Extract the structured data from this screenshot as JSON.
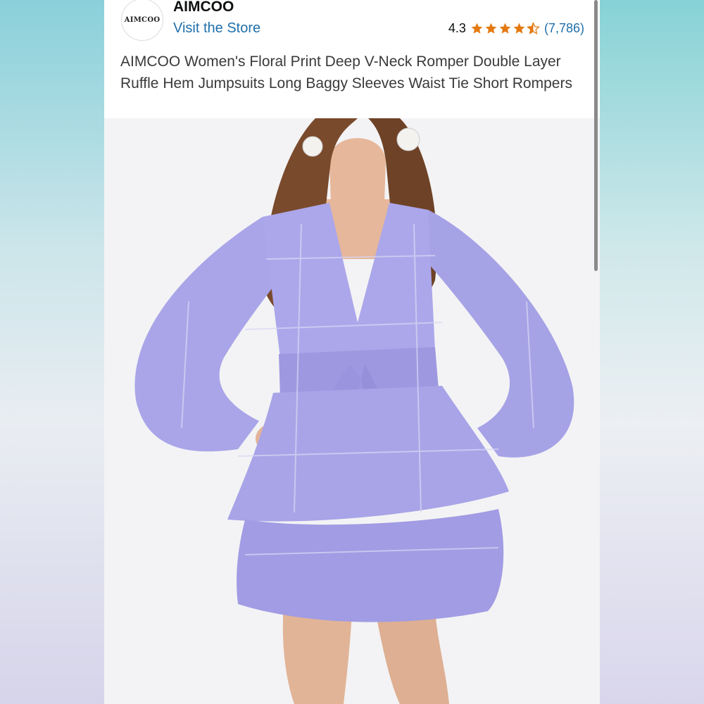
{
  "store": {
    "logo_text": "AIMCOO",
    "brand_name": "AIMCOO",
    "visit_store_label": "Visit the Store"
  },
  "rating": {
    "value": "4.3",
    "stars_filled": 4.5,
    "review_count": "(7,786)",
    "star_color": "#e47911"
  },
  "product": {
    "title": "AIMCOO Women's Floral Print Deep V-Neck Romper Double Layer Ruffle Hem Jumpsuits Long Baggy Sleeves Waist Tie Short Rompers",
    "dress_color": "#a7a3e6",
    "link_color": "#1f6fab"
  }
}
